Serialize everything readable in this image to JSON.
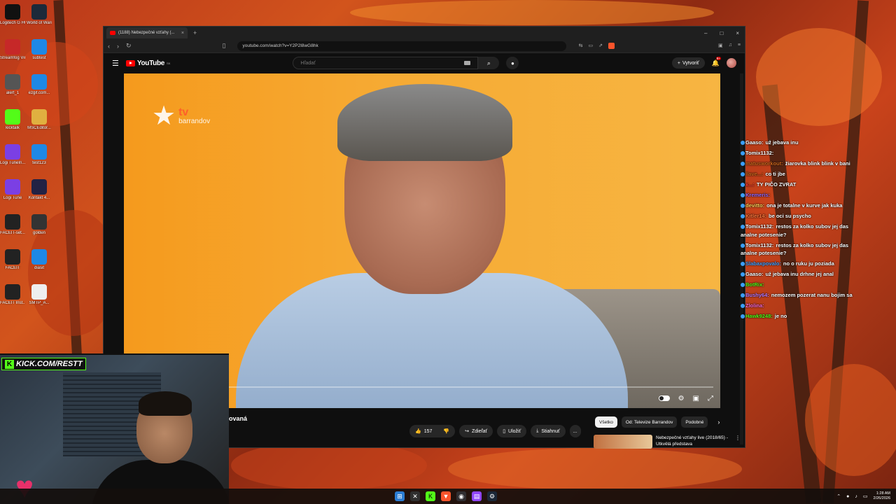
{
  "desktop": {
    "icons": [
      {
        "label": "Logitech G HUB",
        "icon": "g-hub-icon",
        "color": "#111111"
      },
      {
        "label": "World of Warcraft",
        "icon": "wow-icon",
        "color": "#1c2a3a"
      },
      {
        "label": "Streamfog VirtualCam",
        "icon": "streamfog-icon",
        "color": "#c62828"
      },
      {
        "label": "subtest",
        "icon": "globe-icon",
        "color": "#1e88e5"
      },
      {
        "label": "alert_1",
        "icon": "file-icon",
        "color": "#555555"
      },
      {
        "label": "ezgif.com...",
        "icon": "globe-icon",
        "color": "#1e88e5"
      },
      {
        "label": "kicktalk",
        "icon": "kick-icon",
        "color": "#53fc18"
      },
      {
        "label": "MSCEditor...",
        "icon": "folder-icon",
        "color": "#e0b040"
      },
      {
        "label": "Logi TuneIn...",
        "icon": "logi-tune-icon",
        "color": "#7b3fe4"
      },
      {
        "label": "test123",
        "icon": "globe-icon",
        "color": "#1e88e5"
      },
      {
        "label": "Logi Tune",
        "icon": "logi-tune-icon",
        "color": "#7b3fe4"
      },
      {
        "label": "Kontakt 4...",
        "icon": "kontakt-icon",
        "color": "#222244"
      },
      {
        "label": "FACEIT-set...",
        "icon": "faceit-icon",
        "color": "#222222"
      },
      {
        "label": "golden",
        "icon": "golden-icon",
        "color": "#333333"
      },
      {
        "label": "FACEIT",
        "icon": "faceit-icon",
        "color": "#222222"
      },
      {
        "label": "diasit",
        "icon": "globe-icon",
        "color": "#1e88e5"
      },
      {
        "label": "FACEIT Inst...",
        "icon": "faceit-icon",
        "color": "#222222"
      },
      {
        "label": "SMTP_A...",
        "icon": "app-icon",
        "color": "#eeeeee"
      }
    ]
  },
  "browser": {
    "tab_title": "(1188) Nebezpečné vzťahy (...",
    "new_tab": "+",
    "url": "youtube.com/watch?v=Y2P2I8wG8hk",
    "window_controls": [
      "–",
      "□",
      "×"
    ]
  },
  "youtube": {
    "logo_text": "YouTube",
    "logo_country": "SK",
    "search_placeholder": "Hľadať",
    "create_label": "Vytvoriť",
    "notification_badge": "9+",
    "video": {
      "channel_logo_top": "tv",
      "channel_logo_bottom": "barrandov",
      "progress": 0.155
    },
    "title_fragment": "ovaná",
    "actions": {
      "likes": "157",
      "share": "Zdieľať",
      "save": "Uložiť",
      "download": "Stiahnuť",
      "more": "..."
    },
    "chips": [
      "Všetko",
      "Od: Televize Barrandov",
      "Podobné"
    ],
    "recommended": {
      "title": "Nebezpečné vzťahy live (2018/65) - Utkvělá představa"
    }
  },
  "chat": {
    "messages": [
      {
        "user": "Gaaso:",
        "text": "už jebava inu",
        "color": "#ffffff"
      },
      {
        "user": "Tomix1132:",
        "text": "",
        "color": "#ffffff"
      },
      {
        "user": "matusworkout:",
        "text": "žiarovka blink blink v bani",
        "color": "#d2691e"
      },
      {
        "user": "llave...:",
        "text": "co ti jbe",
        "color": "#d2691e"
      },
      {
        "user": "x...:",
        "text": "TY PIČO ZVRAT",
        "color": "#ff3b3b"
      },
      {
        "user": "Kremeris:",
        "text": "",
        "color": "#9b6bff"
      },
      {
        "user": "devitto:",
        "text": "ona je totalne v kurve jak kuka",
        "color": "#ffd35a"
      },
      {
        "user": "Kitler14:",
        "text": "be oci su psycho",
        "color": "#ff7a3d"
      },
      {
        "user": "Tomix1132:",
        "text": "restos za kolko subov jej das analne potesenie?",
        "color": "#ffffff"
      },
      {
        "user": "Tomix1132:",
        "text": "restos za kolko subov jej das analne potesenie?",
        "color": "#ffffff"
      },
      {
        "user": "Slabaxpovalo:",
        "text": "no o ruku ju poziada",
        "color": "#4aa3ff"
      },
      {
        "user": "Gaaso:",
        "text": "už jebava inu drhne jej anal",
        "color": "#ffffff"
      },
      {
        "user": "BotRix:",
        "text": "",
        "color": "#53fc18"
      },
      {
        "user": "Bushy64:",
        "text": "nemozem pozerat nanu bojim sa",
        "color": "#c07cff"
      },
      {
        "user": "Zlolina:",
        "text": "",
        "color": "#ff6bd6"
      },
      {
        "user": "Hawk9248:",
        "text": "je no",
        "color": "#53fc18"
      }
    ]
  },
  "stream": {
    "kick_label": "KICK.COM/RESTT"
  },
  "taskbar": {
    "time": "1:28 AM",
    "date": "2/26/2026"
  }
}
